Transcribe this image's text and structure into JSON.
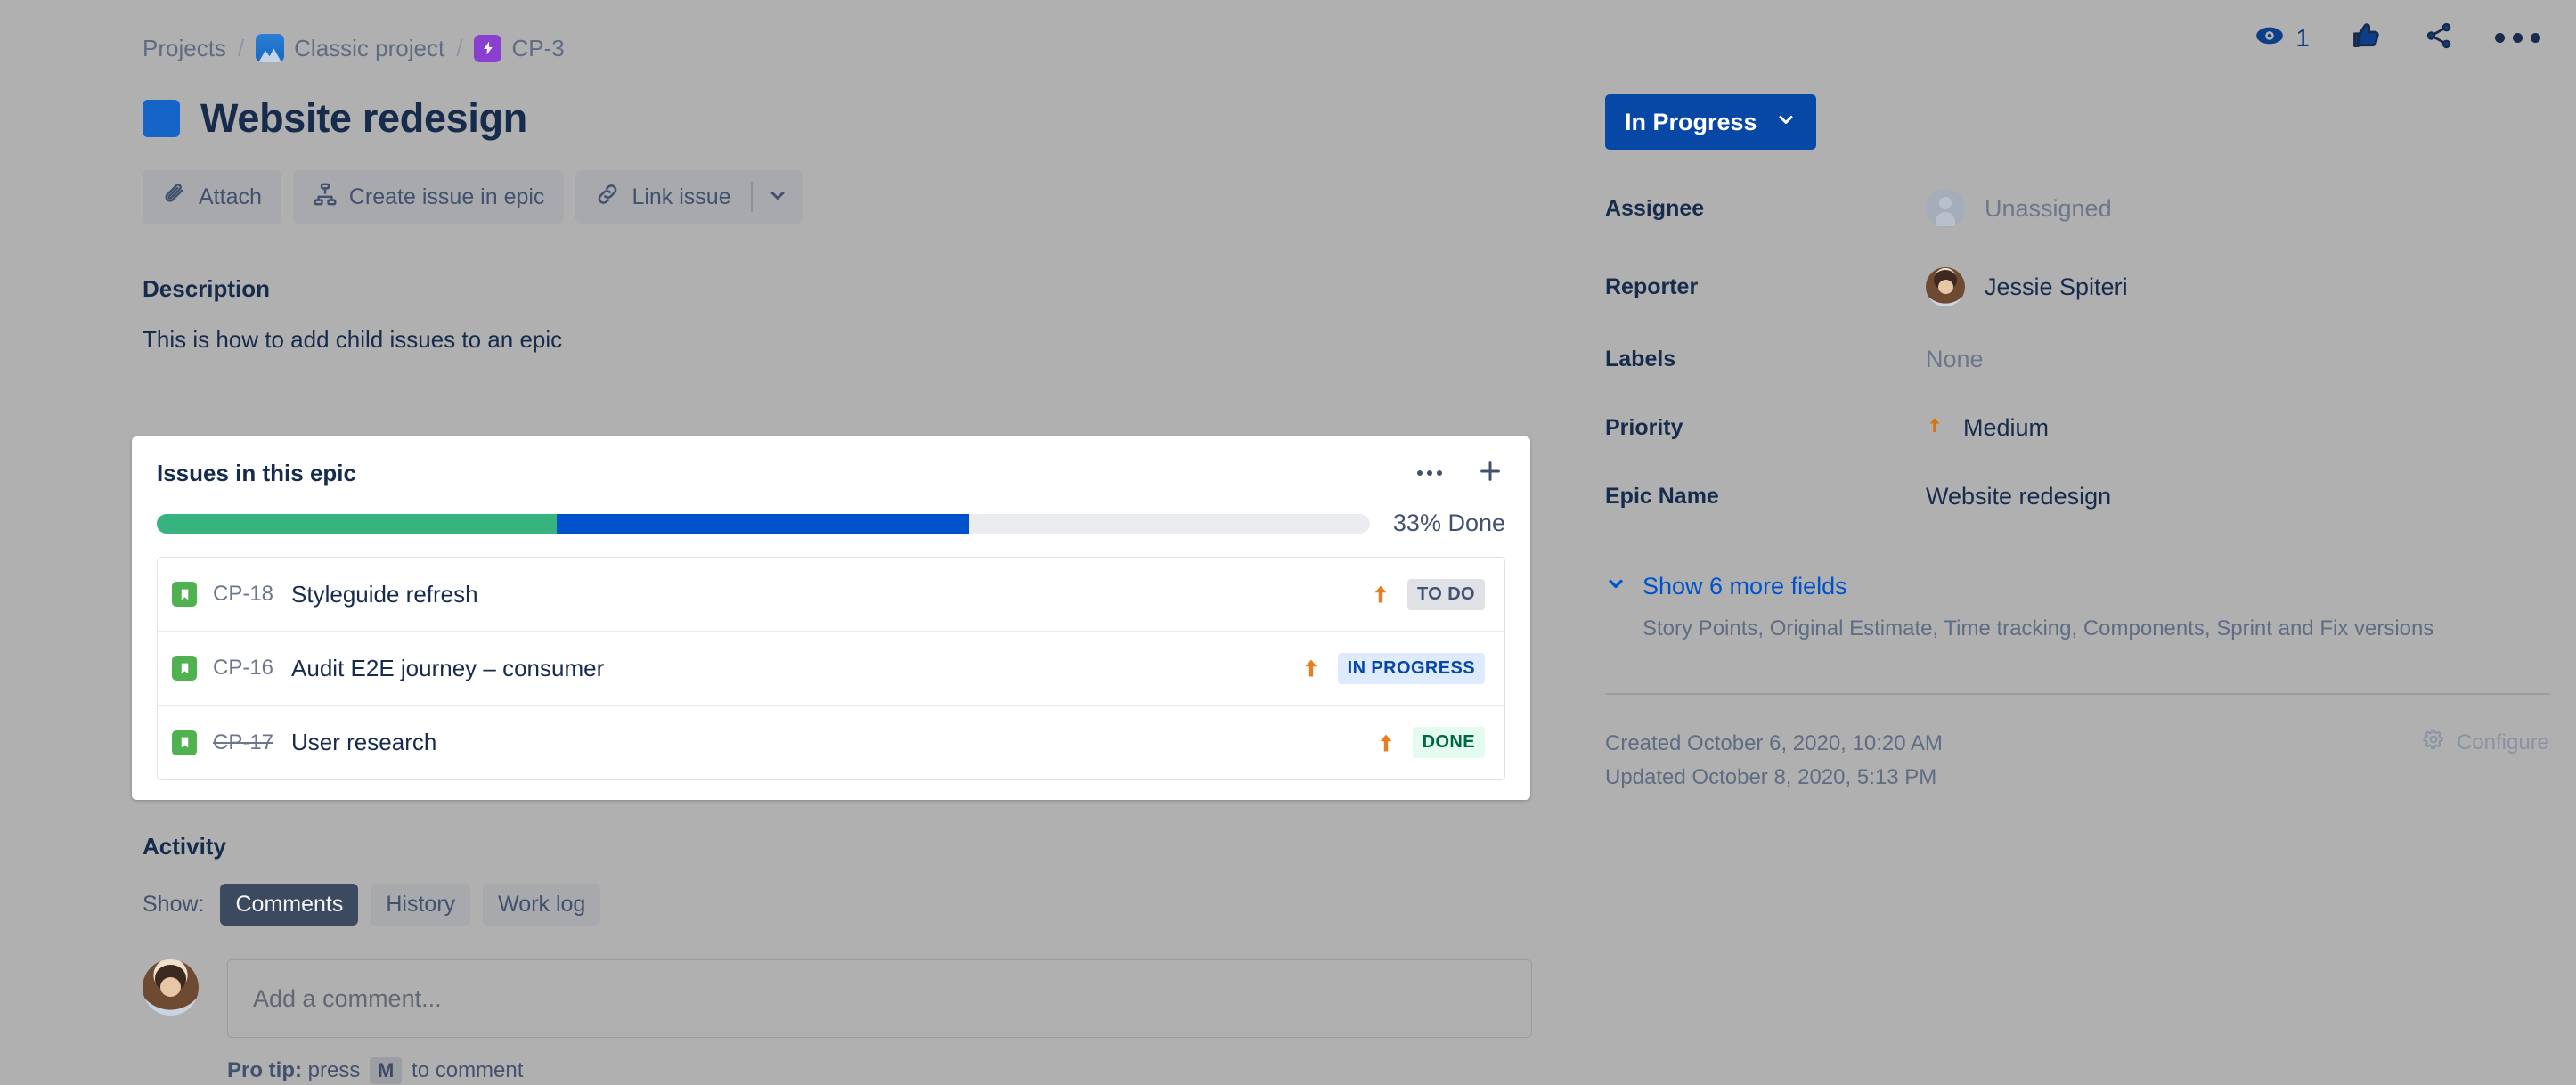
{
  "breadcrumb": {
    "projects": "Projects",
    "project_name": "Classic project",
    "issue_key": "CP-3",
    "separator": "/"
  },
  "header": {
    "title": "Website redesign",
    "watch_count": "1"
  },
  "actions": {
    "attach": "Attach",
    "create_issue_in_epic": "Create issue in epic",
    "link_issue": "Link issue"
  },
  "description": {
    "heading": "Description",
    "body": "This is how to add child issues to an epic"
  },
  "epic_panel": {
    "title": "Issues in this epic",
    "progress_label": "33% Done",
    "progress": {
      "done_pct": 33,
      "in_progress_pct": 34,
      "todo_pct": 33
    },
    "issues": [
      {
        "key": "CP-18",
        "summary": "Styleguide refresh",
        "status": "TO DO",
        "status_class": "todo",
        "priority": "Medium",
        "struck": false
      },
      {
        "key": "CP-16",
        "summary": "Audit E2E journey – consumer",
        "status": "IN PROGRESS",
        "status_class": "inprogress",
        "priority": "Medium",
        "struck": false
      },
      {
        "key": "CP-17",
        "summary": "User research",
        "status": "DONE",
        "status_class": "done",
        "priority": "Medium",
        "struck": true
      }
    ]
  },
  "activity": {
    "heading": "Activity",
    "show_label": "Show:",
    "tabs": [
      {
        "label": "Comments",
        "active": true
      },
      {
        "label": "History",
        "active": false
      },
      {
        "label": "Work log",
        "active": false
      }
    ],
    "comment_placeholder": "Add a comment...",
    "protip_prefix": "Pro tip:",
    "protip_press": "press",
    "protip_key": "M",
    "protip_suffix": "to comment"
  },
  "sidebar": {
    "status": "In Progress",
    "fields": [
      {
        "label": "Assignee",
        "value": "Unassigned",
        "muted": true
      },
      {
        "label": "Reporter",
        "value": "Jessie Spiteri",
        "muted": false
      },
      {
        "label": "Labels",
        "value": "None",
        "muted": true
      },
      {
        "label": "Priority",
        "value": "Medium",
        "muted": false
      },
      {
        "label": "Epic Name",
        "value": "Website redesign",
        "muted": false
      }
    ],
    "more_fields_link": "Show 6 more fields",
    "more_fields_sub": "Story Points, Original Estimate, Time tracking, Components, Sprint and Fix versions",
    "created": "Created October 6, 2020, 10:20 AM",
    "updated": "Updated October 8, 2020, 5:13 PM",
    "configure": "Configure"
  },
  "colors": {
    "page_bg": "#b0b0b0",
    "brand_blue": "#0052cc",
    "status_blue": "#0747a6",
    "done_green": "#36b37e",
    "epic_purple": "#8b3fce",
    "priority_orange": "#d9730d",
    "text": "#172b4d",
    "muted_text": "#6b778c"
  },
  "icons": {
    "watch": "eye-icon",
    "like": "thumbs-up-icon",
    "share": "share-icon",
    "more": "more-options-icon",
    "attach": "paperclip-icon",
    "create_child": "hierarchy-icon",
    "link": "link-icon",
    "caret": "chevron-down-icon",
    "add": "plus-icon",
    "gear": "gear-icon"
  }
}
